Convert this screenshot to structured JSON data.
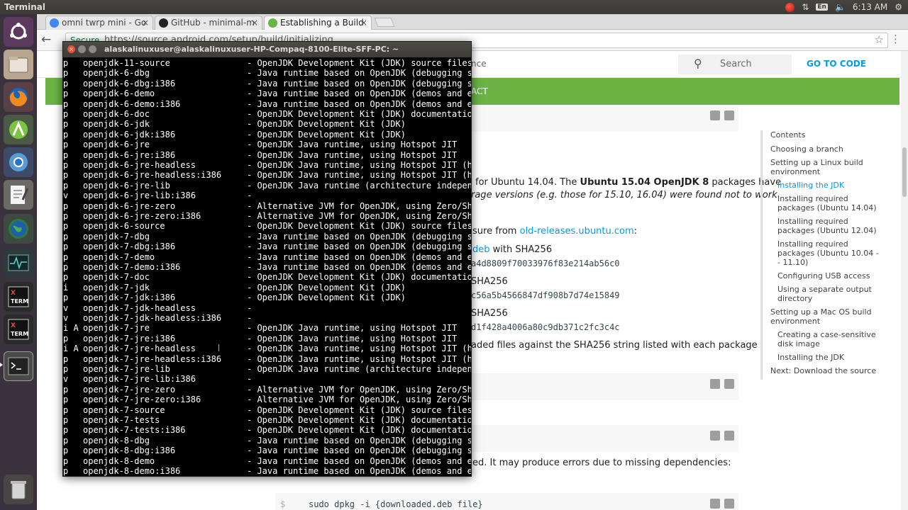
{
  "topbar": {
    "title": "Terminal",
    "time": "6:13 AM",
    "keyboard": "En"
  },
  "launcher": {
    "items": [
      "ubuntu-dash",
      "files",
      "firefox",
      "android-studio",
      "chromium",
      "text-editor",
      "globe",
      "system-monitor",
      "xterm",
      "xterm",
      "terminal",
      "trash"
    ]
  },
  "browser": {
    "tabs": [
      {
        "label": "omni twrp mini - Go",
        "favicon_color": "#4285f4"
      },
      {
        "label": "GitHub - minimal-m",
        "favicon_color": "#222222"
      },
      {
        "label": "Establishing a Build",
        "favicon_color": "#6ab344"
      }
    ],
    "secure_label": "Secure",
    "url": "https://source.android.com/setup/build/initializing"
  },
  "page": {
    "header_partial": "nce",
    "search_placeholder": "Search",
    "goto_code": "GO TO CODE",
    "green_band_partial": "ACT",
    "para1_a": "for Ubuntu 14.04. The",
    "para1_bold": "Ubuntu 15.04 OpenJDK 8",
    "para1_b": "packages have",
    "para1_line2": "rage versions (e.g. those for 15.10, 16.04) were found not to work",
    "para2_a": "sure from",
    "para2_link": "old-releases.ubuntu.com",
    "para2_b": ":",
    "item1_link": "deb",
    "item1_text": "with SHA256",
    "item1_hash": "a4d8809f70033976f83e214ab56c0",
    "item2_text": "SHA256",
    "item2_hash": "c56a5b4566847df908b7d74e15849",
    "item3_text": "SHA256",
    "item3_hash": "d1f428a4006a80c9db371c2fc3c4c",
    "para3": "aded files against the SHA256 string listed with each package",
    "para4": "ed. It may produce errors due to missing dependencies:",
    "code_prompt": "$",
    "code_cmd": "sudo dpkg -i {downloaded.deb file}"
  },
  "toc": {
    "heading": "Contents",
    "items": [
      {
        "label": "Choosing a branch",
        "level": 1
      },
      {
        "label": "Setting up a Linux build environment",
        "level": 1
      },
      {
        "label": "Installing the JDK",
        "level": 2,
        "active": true
      },
      {
        "label": "Installing required packages (Ubuntu 14.04)",
        "level": 2
      },
      {
        "label": "Installing required packages (Ubuntu 12.04)",
        "level": 2
      },
      {
        "label": "Installing required packages (Ubuntu 10.04 -- 11.10)",
        "level": 2
      },
      {
        "label": "Configuring USB access",
        "level": 2
      },
      {
        "label": "Using a separate output directory",
        "level": 2
      },
      {
        "label": "Setting up a Mac OS build environment",
        "level": 1
      },
      {
        "label": "Creating a case-sensitive disk image",
        "level": 2
      },
      {
        "label": "Installing the JDK",
        "level": 2
      },
      {
        "label": "Next: Download the source",
        "level": 1
      }
    ]
  },
  "terminal": {
    "title": "alaskalinuxuser@alaskalinuxuser-HP-Compaq-8100-Elite-SFF-PC: ~",
    "lines": [
      {
        "s": "p",
        "p": "openjdk-11-source",
        "d": "- OpenJDK Development Kit (JDK) source files"
      },
      {
        "s": "p",
        "p": "openjdk-6-dbg",
        "d": "- Java runtime based on OpenJDK (debugging sy"
      },
      {
        "s": "p",
        "p": "openjdk-6-dbg:i386",
        "d": "- Java runtime based on OpenJDK (debugging sy"
      },
      {
        "s": "p",
        "p": "openjdk-6-demo",
        "d": "- Java runtime based on OpenJDK (demos and e"
      },
      {
        "s": "p",
        "p": "openjdk-6-demo:i386",
        "d": "- Java runtime based on OpenJDK (demos and e"
      },
      {
        "s": "p",
        "p": "openjdk-6-doc",
        "d": "- OpenJDK Development Kit (JDK) documentatio"
      },
      {
        "s": "p",
        "p": "openjdk-6-jdk",
        "d": "- OpenJDK Development Kit (JDK)"
      },
      {
        "s": "p",
        "p": "openjdk-6-jdk:i386",
        "d": "- OpenJDK Development Kit (JDK)"
      },
      {
        "s": "p",
        "p": "openjdk-6-jre",
        "d": "- OpenJDK Java runtime, using Hotspot JIT"
      },
      {
        "s": "p",
        "p": "openjdk-6-jre:i386",
        "d": "- OpenJDK Java runtime, using Hotspot JIT"
      },
      {
        "s": "p",
        "p": "openjdk-6-jre-headless",
        "d": "- OpenJDK Java runtime, using Hotspot JIT (h"
      },
      {
        "s": "p",
        "p": "openjdk-6-jre-headless:i386",
        "d": "- OpenJDK Java runtime, using Hotspot JIT (h"
      },
      {
        "s": "p",
        "p": "openjdk-6-jre-lib",
        "d": "- OpenJDK Java runtime (architecture indepen"
      },
      {
        "s": "v",
        "p": "openjdk-6-jre-lib:i386",
        "d": "-"
      },
      {
        "s": "p",
        "p": "openjdk-6-jre-zero",
        "d": "- Alternative JVM for OpenJDK, using Zero/Sh"
      },
      {
        "s": "p",
        "p": "openjdk-6-jre-zero:i386",
        "d": "- Alternative JVM for OpenJDK, using Zero/Sh"
      },
      {
        "s": "p",
        "p": "openjdk-6-source",
        "d": "- OpenJDK Development Kit (JDK) source files"
      },
      {
        "s": "p",
        "p": "openjdk-7-dbg",
        "d": "- Java runtime based on OpenJDK (debugging s"
      },
      {
        "s": "p",
        "p": "openjdk-7-dbg:i386",
        "d": "- Java runtime based on OpenJDK (debugging s"
      },
      {
        "s": "p",
        "p": "openjdk-7-demo",
        "d": "- Java runtime based on OpenJDK (demos and e"
      },
      {
        "s": "p",
        "p": "openjdk-7-demo:i386",
        "d": "- Java runtime based on OpenJDK (demos and e"
      },
      {
        "s": "p",
        "p": "openjdk-7-doc",
        "d": "- OpenJDK Development Kit (JDK) documentatio"
      },
      {
        "s": "i",
        "p": "openjdk-7-jdk",
        "d": "- OpenJDK Development Kit (JDK)"
      },
      {
        "s": "p",
        "p": "openjdk-7-jdk:i386",
        "d": "- OpenJDK Development Kit (JDK)"
      },
      {
        "s": "v",
        "p": "openjdk-7-jdk-headless",
        "d": "-"
      },
      {
        "s": "v",
        "p": "openjdk-7-jdk-headless:i386",
        "d": "-"
      },
      {
        "s": "i A",
        "p": "openjdk-7-jre",
        "d": "- OpenJDK Java runtime, using Hotspot JIT"
      },
      {
        "s": "p",
        "p": "openjdk-7-jre:i386",
        "d": "- OpenJDK Java runtime, using Hotspot JIT"
      },
      {
        "s": "i A",
        "p": "openjdk-7-jre-headless",
        "d": "- OpenJDK Java runtime, using Hotspot JIT (h"
      },
      {
        "s": "p",
        "p": "openjdk-7-jre-headless:i386",
        "d": "- OpenJDK Java runtime, using Hotspot JIT (h"
      },
      {
        "s": "p",
        "p": "openjdk-7-jre-lib",
        "d": "- OpenJDK Java runtime (architecture indepen"
      },
      {
        "s": "v",
        "p": "openjdk-7-jre-lib:i386",
        "d": "-"
      },
      {
        "s": "p",
        "p": "openjdk-7-jre-zero",
        "d": "- Alternative JVM for OpenJDK, using Zero/Sh"
      },
      {
        "s": "p",
        "p": "openjdk-7-jre-zero:i386",
        "d": "- Alternative JVM for OpenJDK, using Zero/Sh"
      },
      {
        "s": "p",
        "p": "openjdk-7-source",
        "d": "- OpenJDK Development Kit (JDK) source files"
      },
      {
        "s": "p",
        "p": "openjdk-7-tests",
        "d": "- OpenJDK Development Kit (JDK) documentatio"
      },
      {
        "s": "p",
        "p": "openjdk-7-tests:i386",
        "d": "- OpenJDK Development Kit (JDK) documentatio"
      },
      {
        "s": "p",
        "p": "openjdk-8-dbg",
        "d": "- Java runtime based on OpenJDK (debugging s"
      },
      {
        "s": "p",
        "p": "openjdk-8-dbg:i386",
        "d": "- Java runtime based on OpenJDK (debugging s"
      },
      {
        "s": "p",
        "p": "openjdk-8-demo",
        "d": "- Java runtime based on OpenJDK (demos and e"
      },
      {
        "s": "p",
        "p": "openjdk-8-demo:i386",
        "d": "- Java runtime based on OpenJDK (demos and e"
      }
    ]
  }
}
